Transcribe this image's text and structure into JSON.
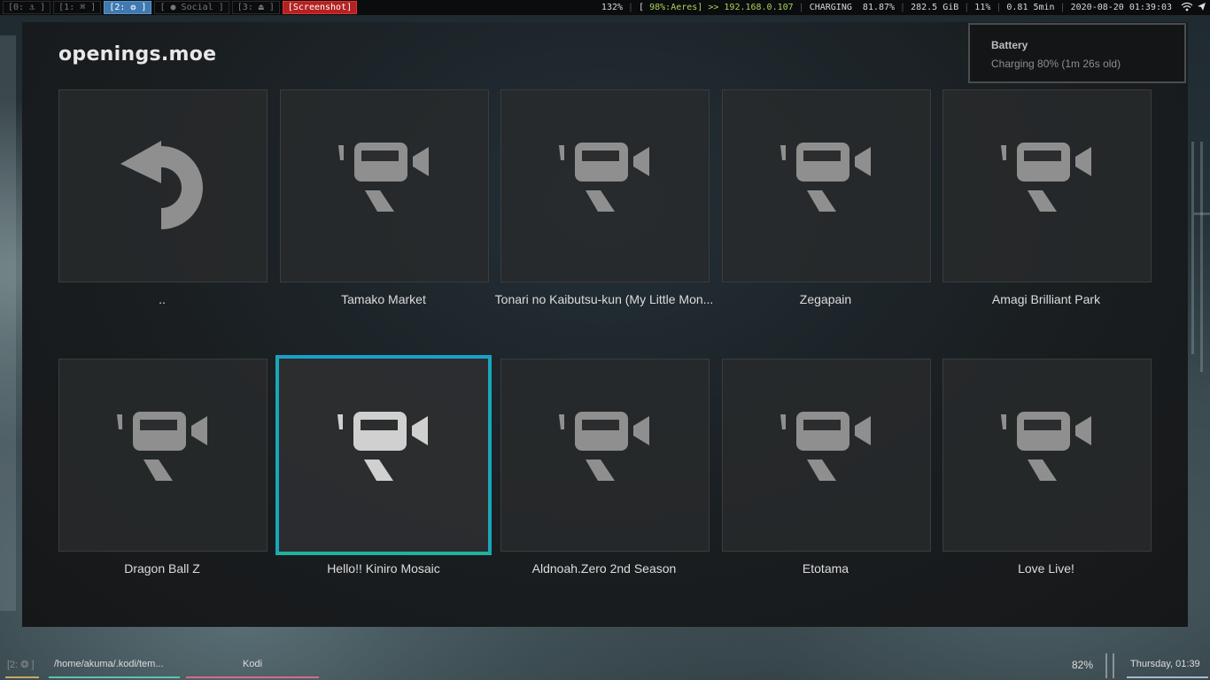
{
  "topbar": {
    "workspaces": [
      {
        "label": "[0: ⚓ ]",
        "state": "normal"
      },
      {
        "label": "[1: ⌘ ]",
        "state": "normal"
      },
      {
        "label": "[2: ❂ ]",
        "state": "active"
      },
      {
        "label": "[ ● Social ]",
        "state": "normal"
      },
      {
        "label": "[3: ⏏ ]",
        "state": "normal"
      },
      {
        "label": "[Screenshot]",
        "state": "alert"
      }
    ],
    "brightness": "132%",
    "network_prefix": "[",
    "network": "98%:Aeres] >> 192.168.0.107",
    "battery_state": "CHARGING",
    "battery_level": "81.87%",
    "disk": "282.5 GiB",
    "cpu": "11%",
    "load": "0.81 5min",
    "datetime": "2020-08-20 01:39:03"
  },
  "kodi": {
    "title": "openings.moe",
    "items": [
      {
        "label": "..",
        "icon": "back-arrow-icon"
      },
      {
        "label": "Tamako Market",
        "icon": "video-camera-icon"
      },
      {
        "label": "Tonari no Kaibutsu-kun (My Little Mon...",
        "icon": "video-camera-icon"
      },
      {
        "label": "Zegapain",
        "icon": "video-camera-icon"
      },
      {
        "label": "Amagi Brilliant Park",
        "icon": "video-camera-icon"
      },
      {
        "label": "Dragon Ball Z",
        "icon": "video-camera-icon"
      },
      {
        "label": "Hello!! Kiniro Mosaic",
        "icon": "video-camera-icon",
        "focused": true
      },
      {
        "label": "Aldnoah.Zero 2nd Season",
        "icon": "video-camera-icon"
      },
      {
        "label": "Etotama",
        "icon": "video-camera-icon"
      },
      {
        "label": "Love Live!",
        "icon": "video-camera-icon"
      }
    ]
  },
  "notification": {
    "title": "Battery",
    "body": "Charging 80% (1m 26s old)"
  },
  "taskbar": {
    "workspace": "[2: ❂ ]",
    "path": "/home/akuma/.kodi/tem...",
    "app": "Kodi",
    "volume": "82%",
    "clock": "Thursday, 01:39"
  },
  "colors": {
    "focus_top": "#1aa0c8",
    "focus_bottom": "#1fb39a",
    "active_ws": "#3f79b0",
    "alert_ws": "#b32222"
  }
}
